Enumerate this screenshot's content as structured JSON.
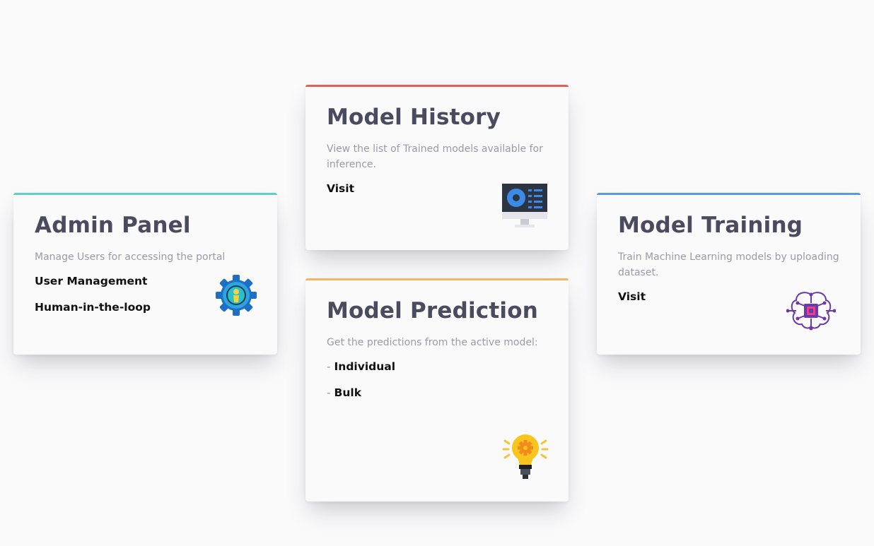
{
  "colors": {
    "admin_accent": "#5fd0c6",
    "history_accent": "#d9625c",
    "prediction_accent": "#f2b466",
    "training_accent": "#5b9ad4",
    "heading": "#4a4b5e",
    "description": "#9b9ba6",
    "link": "#111111"
  },
  "cards": {
    "admin": {
      "title": "Admin Panel",
      "description": "Manage Users for accessing the portal",
      "links": [
        "User Management",
        "Human-in-the-loop"
      ],
      "icon": "gear-user-icon"
    },
    "history": {
      "title": "Model History",
      "description": "View the list of Trained models available for inference.",
      "link": "Visit",
      "icon": "monitor-dashboard-icon"
    },
    "prediction": {
      "title": "Model Prediction",
      "description": "Get the predictions from the active model:",
      "link_prefix": "- ",
      "links": [
        "Individual",
        "Bulk"
      ],
      "icon": "light-bulb-gear-icon"
    },
    "training": {
      "title": "Model Training",
      "description": "Train Machine Learning models by uploading dataset.",
      "link": "Visit",
      "icon": "brain-chip-icon"
    }
  }
}
